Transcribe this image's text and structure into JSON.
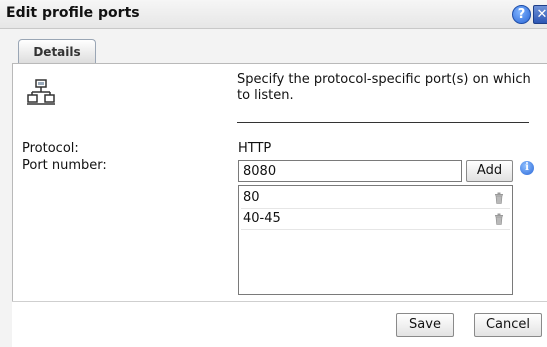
{
  "dialog": {
    "title": "Edit profile ports",
    "help_glyph": "?",
    "close_glyph": "✕"
  },
  "tabs": [
    {
      "label": "Details",
      "selected": true
    }
  ],
  "details": {
    "icon": "network-icon",
    "intro_text": "Specify the protocol-specific port(s) on which to listen.",
    "protocol_label": "Protocol:",
    "protocol_value": "HTTP",
    "port_label": "Port number:",
    "port_input_value": "8080",
    "add_label": "Add",
    "info_glyph": "i",
    "ports": [
      {
        "value": "80"
      },
      {
        "value": "40-45"
      }
    ]
  },
  "footer": {
    "save_label": "Save",
    "cancel_label": "Cancel"
  },
  "colors": {
    "title_bar": "#e6e6e6",
    "help_blue": "#2b66d6",
    "content_bg": "#ffffff"
  }
}
